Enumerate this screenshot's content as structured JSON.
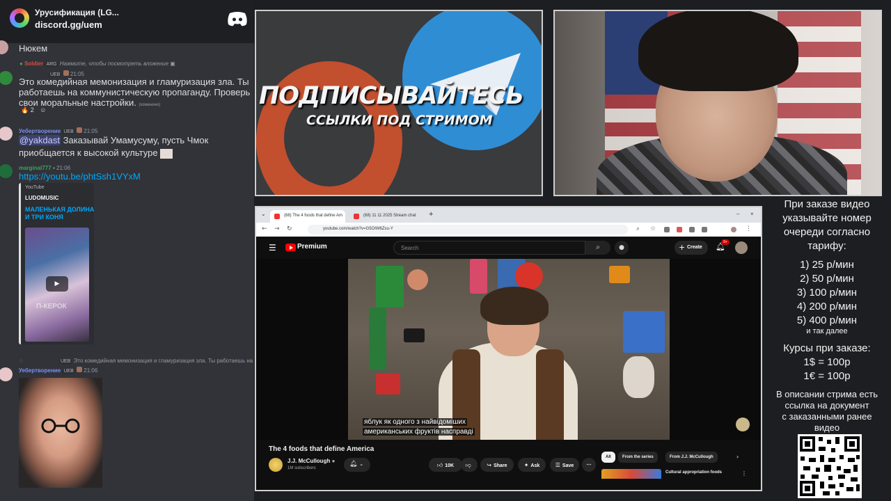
{
  "discord": {
    "server_name": "Урусификация (LG...",
    "invite": "discord.gg/uem",
    "messages": [
      {
        "text": "Нюкем"
      },
      {
        "reply_user": "Soldier",
        "reply_badge": "ARG",
        "reply_text": "Нажмите, чтобы посмотреть вложение",
        "badge": "UEB",
        "time": "21:05",
        "text": "Это комедийная мемонизация и гламуризация зла. Ты работаешь на коммунистическую пропаганду. Проверь свои моральные настройки.",
        "edited": "(изменено)",
        "reactions": [
          "2"
        ]
      },
      {
        "user": "Уебертворение",
        "badge": "UEB",
        "time": "21:05",
        "mention": "@yakdast",
        "text": "Заказывай Умамусуму, пусть Чмок приобщается к высокой культуре"
      },
      {
        "user": "marginal777",
        "time": "21:06",
        "link": "https://youtu.be/phtSsh1VYxM",
        "embed": {
          "provider": "YouTube",
          "author": "LUDOMUSIC",
          "title": "МАЛЕНЬКАЯ ДОЛИНА И ТРИ КОНЯ",
          "watermark": "П-КЕРОК"
        }
      },
      {
        "reply_badge": "UEB",
        "reply_text": "Это комедийная мемонизация и гламуризация зла. Ты работаешь на коммун",
        "user": "Уебертворение",
        "badge": "UEB",
        "time": "21:06"
      }
    ]
  },
  "promo": {
    "title": "ПОДПИСЫВАЙТЕСЬ",
    "subtitle": "ССЫЛКИ ПОД СТРИМОМ"
  },
  "browser": {
    "tabs": [
      {
        "label": "(68) The 4 foods that define Am"
      },
      {
        "label": "(68) 11 11 2025 Stream chat"
      }
    ],
    "url": "youtube.com/watch?v=G5OIW6Zsu-Y",
    "youtube": {
      "brand": "Premium",
      "search_placeholder": "Search",
      "create_label": "Create",
      "notifications": "9+",
      "subtitle_line1": "яблук як одного з найвідоміших",
      "subtitle_line2": "американських фруктів насправді",
      "video_title": "The 4 foods that define America",
      "channel": "J.J. McCullough",
      "subscribers": "1M subscribers",
      "likes": "10K",
      "share": "Share",
      "ask": "Ask",
      "save": "Save",
      "chips": [
        "All",
        "From the series",
        "From J.J. McCullough"
      ],
      "rec_title": "Cultural appropriation foods"
    }
  },
  "pricing": {
    "heading": [
      "При заказе видео",
      "указывайте номер",
      "очереди согласно",
      "тарифу:"
    ],
    "tiers": [
      "1) 25 р/мин",
      "2) 50 р/мин",
      "3) 100 р/мин",
      "4) 200 р/мин",
      "5) 400 р/мин"
    ],
    "etc": "и так далее",
    "rates_heading": "Курсы при заказе:",
    "rates": [
      "1$ = 100р",
      "1€ = 100р"
    ],
    "note": [
      "В описании стрима есть",
      "ссылка на документ",
      "с заказанными ранее",
      "видео"
    ]
  },
  "colors": {
    "discord_bg": "#313338",
    "link": "#00a8fc",
    "yt_red": "#ff0000"
  }
}
